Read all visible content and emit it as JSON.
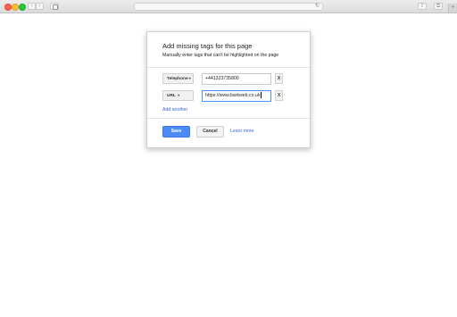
{
  "browser": {
    "reload_glyph": "↻",
    "back_glyph": "‹",
    "forward_glyph": "›",
    "share_glyph": "⇪",
    "tabs_glyph": "⧉",
    "newtab_glyph": "+"
  },
  "dialog": {
    "title": "Add missing tags for this page",
    "subtitle": "Manually enter tags that can't be highlighted on the page",
    "rows": [
      {
        "type_label": "Telephone",
        "value": "+441323735800",
        "remove_label": "X"
      },
      {
        "type_label": "URL",
        "value": "https://www.barkweb.co.uk",
        "remove_label": "X"
      }
    ],
    "caret_glyph": "▾",
    "add_another_label": "Add another",
    "save_label": "Save",
    "cancel_label": "Cancel",
    "learn_more_label": "Learn more"
  },
  "colors": {
    "accent": "#4c8bf5",
    "link": "#3367d6",
    "focus_border": "#4d90fe"
  }
}
